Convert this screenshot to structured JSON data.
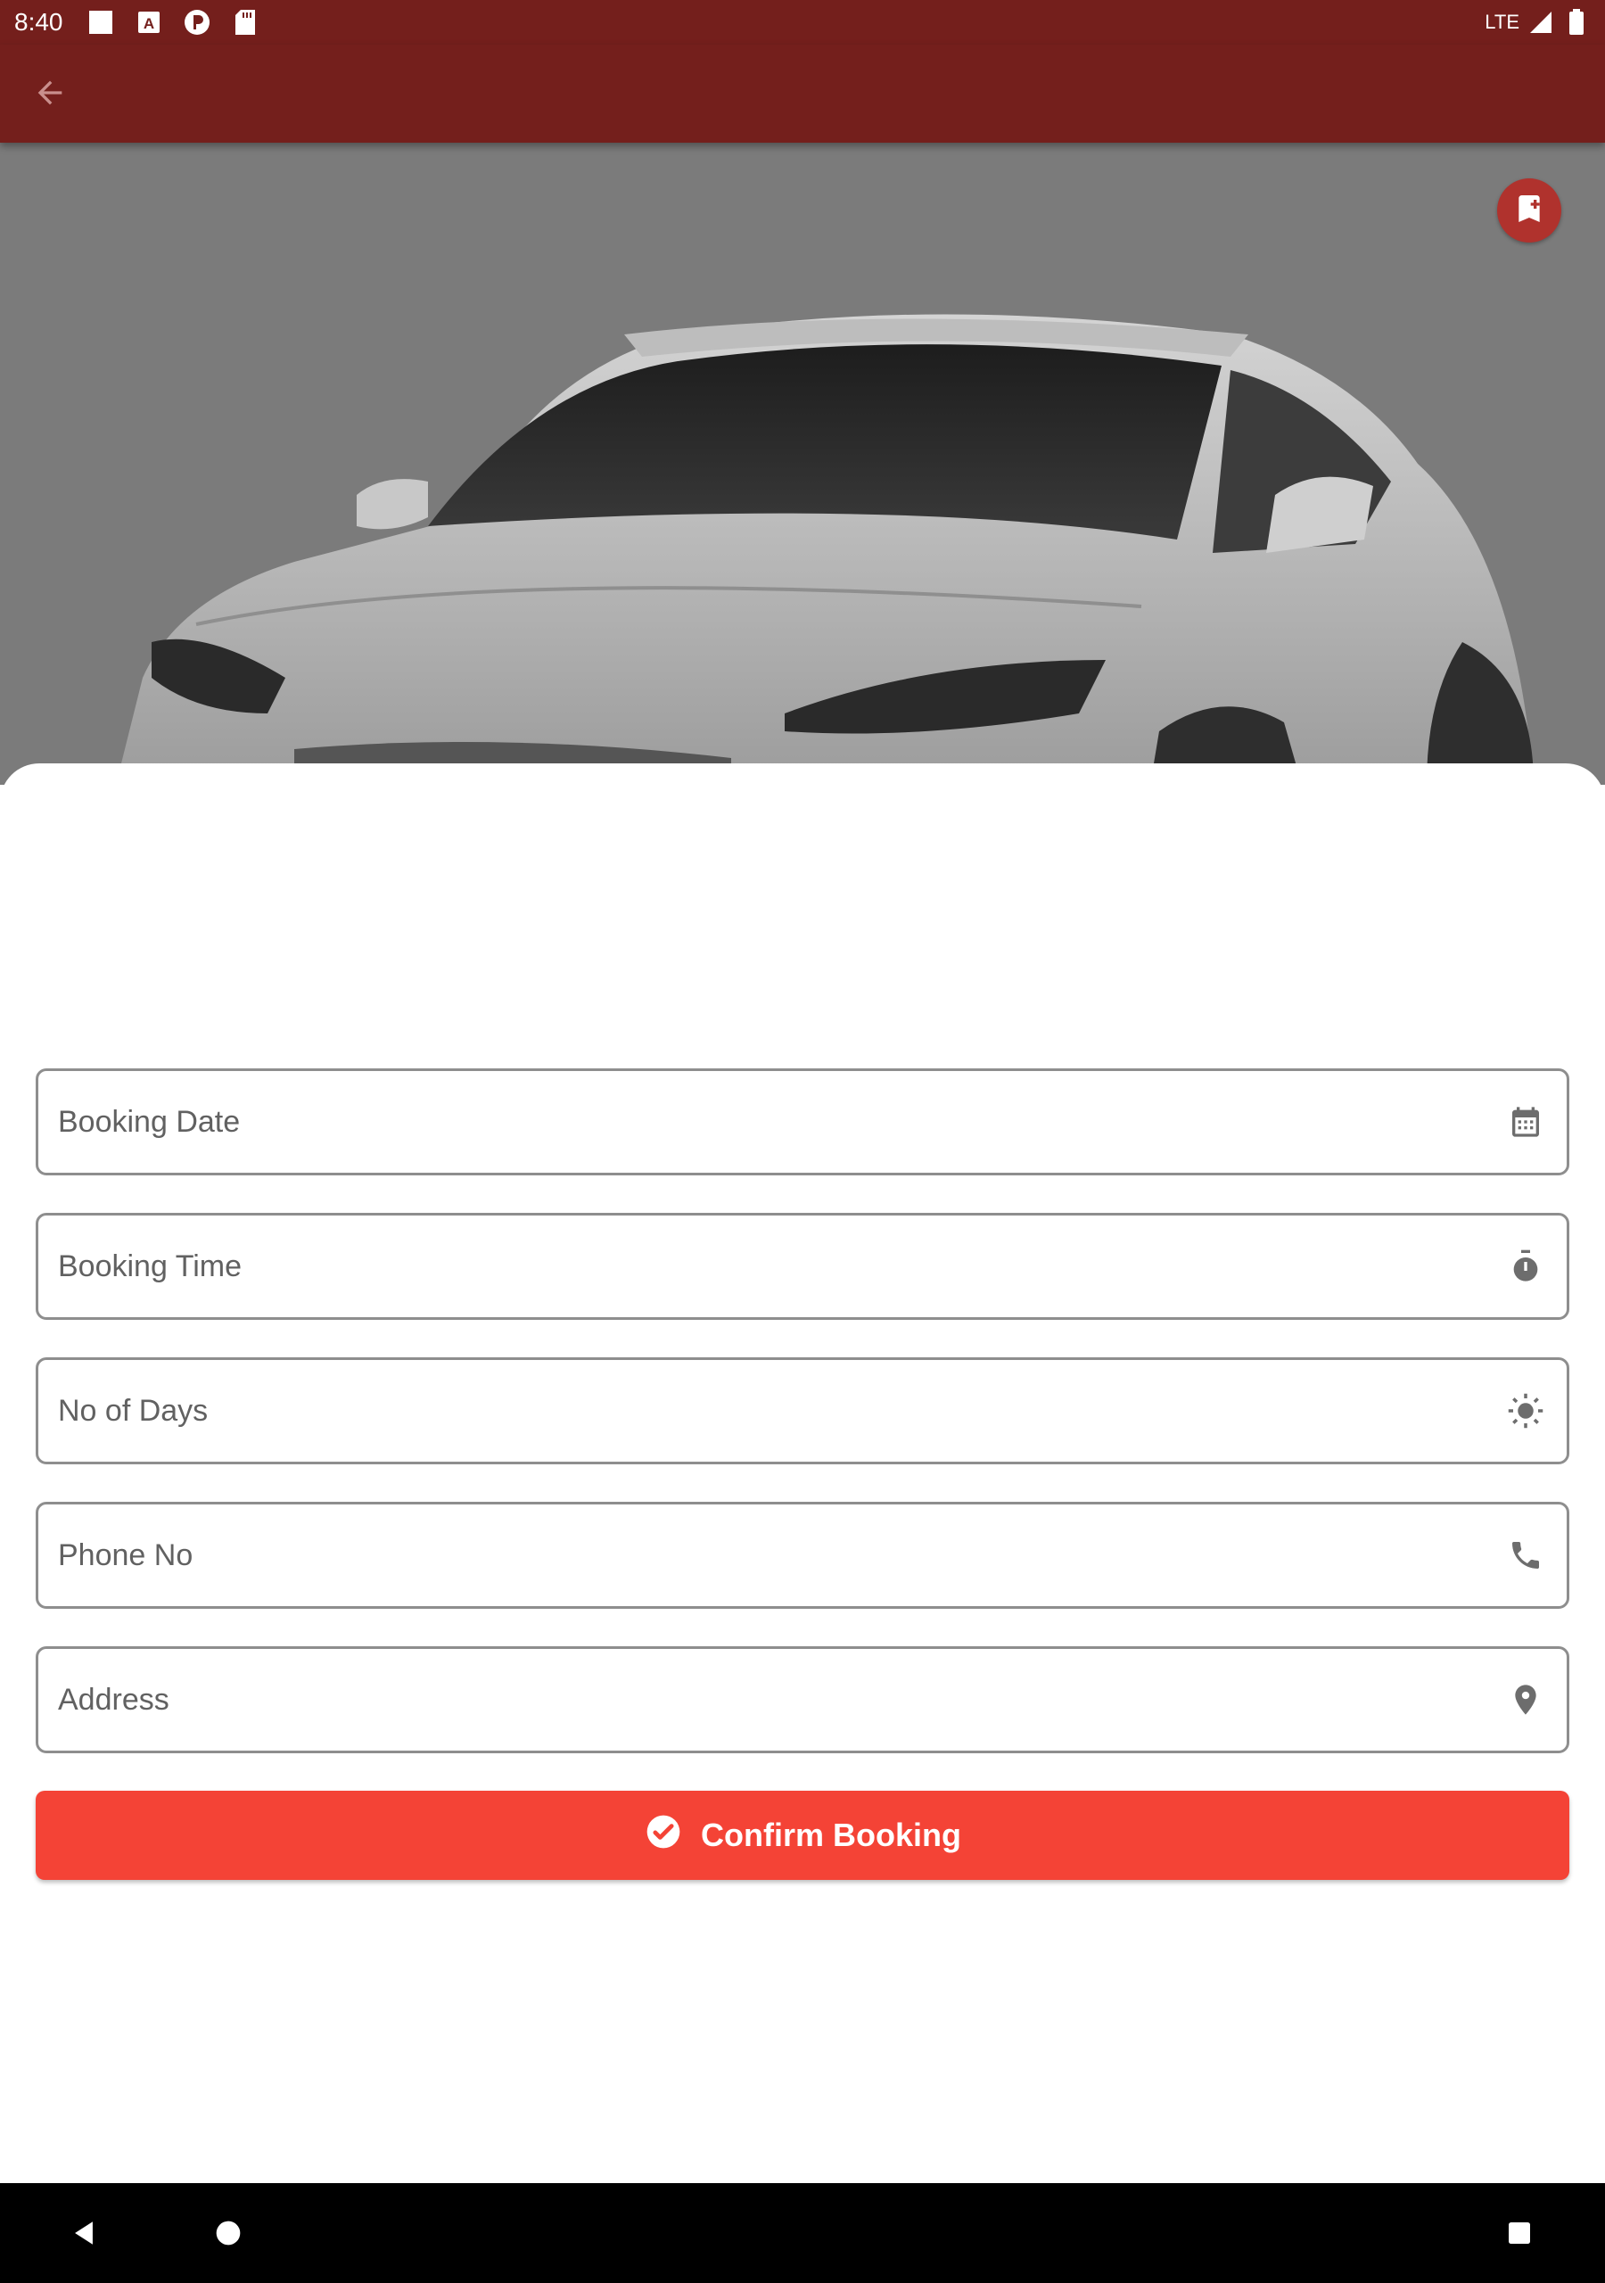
{
  "status_bar": {
    "time": "8:40",
    "network": "LTE",
    "icons": [
      "white-square-icon",
      "font-icon",
      "circle-p-icon",
      "sd-card-icon",
      "signal-icon",
      "battery-icon"
    ]
  },
  "app_bar": {
    "back_icon": "arrow-back-icon",
    "color": "#741f1c"
  },
  "hero": {
    "image": "white sedan car photo",
    "bookmark_icon": "bookmark-add-icon"
  },
  "form": {
    "fields": [
      {
        "placeholder": "Booking Date",
        "icon": "calendar-icon"
      },
      {
        "placeholder": "Booking Time",
        "icon": "timer-icon"
      },
      {
        "placeholder": "No of Days",
        "icon": "sun-icon"
      },
      {
        "placeholder": "Phone No",
        "icon": "phone-icon"
      },
      {
        "placeholder": "Address",
        "icon": "location-pin-icon"
      }
    ],
    "confirm_label": "Confirm Booking",
    "confirm_icon": "check-circle-icon",
    "accent": "#f44336"
  },
  "nav_bar": {
    "icons": [
      "nav-back-icon",
      "nav-home-icon",
      "nav-recents-icon"
    ]
  }
}
